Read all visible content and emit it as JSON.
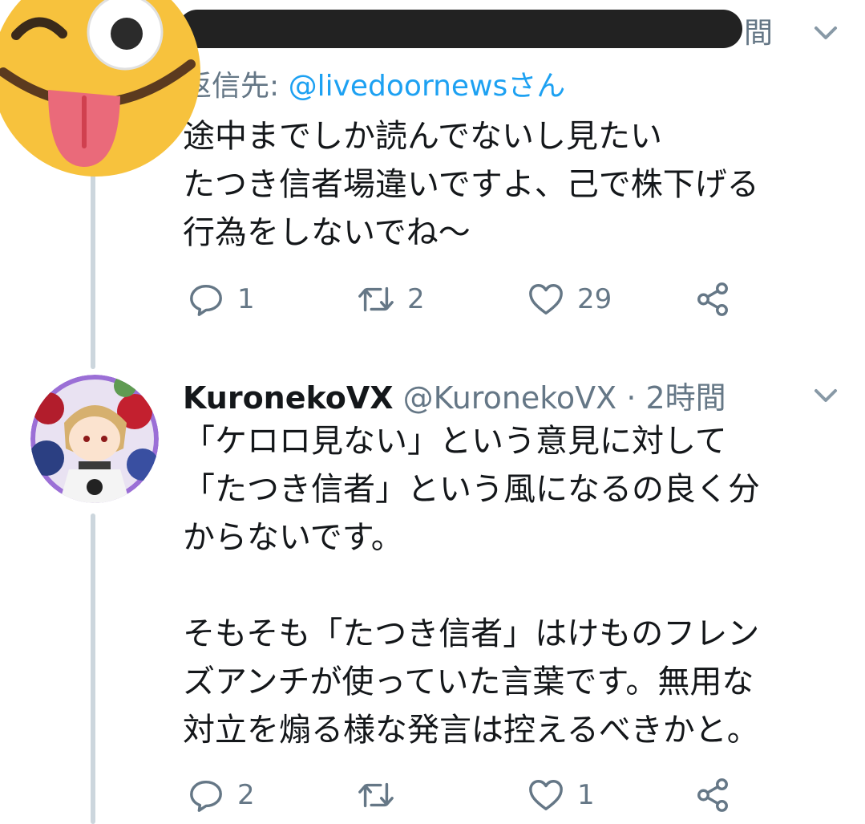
{
  "tweet1": {
    "time_partial": "間",
    "reply_to_label": "返信先: ",
    "reply_to_handle": "@livedoornewsさん",
    "body": "途中までしか読んでないし見たい\nたつき信者場違いですよ、己で株下げる\n行為をしないでね〜",
    "actions": {
      "reply_count": "1",
      "retweet_count": "2",
      "like_count": "29"
    }
  },
  "tweet2": {
    "display_name": "KuronekoVX",
    "handle": "@KuronekoVX",
    "separator": "·",
    "time": "2時間",
    "body": "「ケロロ見ない」という意見に対して\n「たつき信者」という風になるの良く分\nからないです。\n\nそもそも「たつき信者」はけものフレン\nズアンチが使っていた言葉です。無用な\n対立を煽る様な発言は控えるべきかと。",
    "actions": {
      "reply_count": "2",
      "like_count": "1"
    }
  },
  "colors": {
    "text": "#14171a",
    "muted": "#657786",
    "link": "#1da1f2",
    "thread_line": "#ccd6dd",
    "redaction": "#222222",
    "emoji": "#f7c23d"
  },
  "icons": [
    "reply-icon",
    "retweet-icon",
    "like-icon",
    "share-icon",
    "chevron-down-icon",
    "winking-tongue-emoji"
  ]
}
